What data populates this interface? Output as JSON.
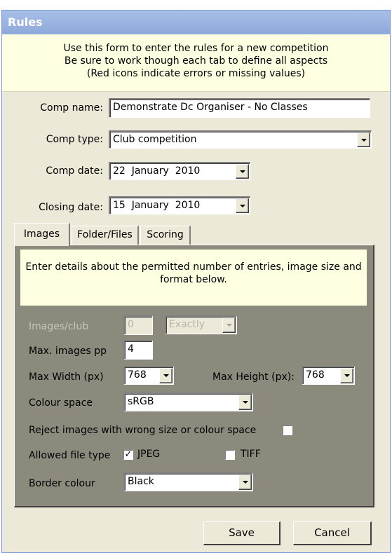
{
  "window": {
    "title": "Rules"
  },
  "intro": {
    "line1": "Use this form to enter the rules for a new competition",
    "line2": "Be sure to work though each tab to define all aspects",
    "line3": "(Red icons indicate errors or missing values)"
  },
  "form": {
    "comp_name_label": "Comp name:",
    "comp_name_value": "Demonstrate Dc Organiser - No Classes",
    "comp_type_label": "Comp type:",
    "comp_type_value": "Club competition",
    "comp_date_label": "Comp date:",
    "comp_date_value": "22  January  2010",
    "closing_date_label": "Closing date:",
    "closing_date_value": "15  January  2010"
  },
  "tabs": [
    "Images",
    "Folder/Files",
    "Scoring"
  ],
  "images_tab": {
    "note": "Enter details about the permitted number of entries, image size and format below.",
    "images_club_label": "Images/club",
    "images_club_value": "0",
    "images_club_mode": "Exactly",
    "max_images_label": "Max. images pp",
    "max_images_value": "4",
    "max_width_label": "Max Width (px)",
    "max_width_value": "768",
    "max_height_label": "Max Height (px):",
    "max_height_value": "768",
    "colour_space_label": "Colour space",
    "colour_space_value": "sRGB",
    "reject_label": "Reject images with wrong size or colour space",
    "reject_checked": false,
    "allowed_label": "Allowed file type",
    "jpeg_label": "JPEG",
    "jpeg_checked": true,
    "tiff_label": "TIFF",
    "tiff_checked": false,
    "border_colour_label": "Border colour",
    "border_colour_value": "Black"
  },
  "buttons": {
    "save": "Save",
    "cancel": "Cancel"
  },
  "colors": {
    "titlebar": "#8da9db",
    "info_bg": "#ffffe1",
    "panel_bg": "#8c8a7c",
    "dialog_bg": "#ece9d8"
  }
}
